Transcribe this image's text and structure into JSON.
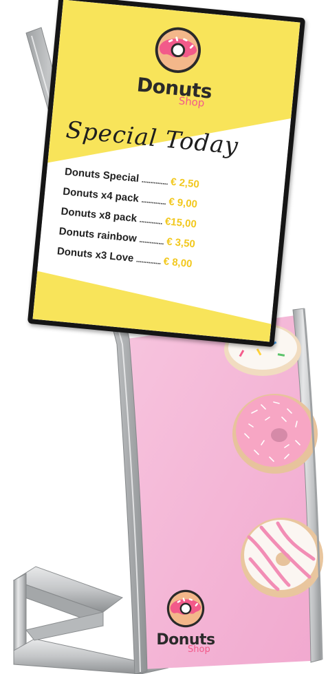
{
  "screen": {
    "brand_main": "Donuts",
    "brand_sub": "Shop",
    "special_title": "Special Today",
    "menu": [
      {
        "name": "Donuts Special",
        "dots": "...............",
        "price": "€ 2,50"
      },
      {
        "name": "Donuts x4 pack",
        "dots": "..............",
        "price": "€ 9,00"
      },
      {
        "name": "Donuts x8 pack",
        "dots": ".............",
        "price": "€15,00"
      },
      {
        "name": "Donuts rainbow",
        "dots": "..............",
        "price": "€ 3,50"
      },
      {
        "name": "Donuts x3 Love",
        "dots": "..............",
        "price": "€ 8,00"
      }
    ]
  },
  "poster": {
    "brand_main": "Donuts",
    "brand_sub": "Shop"
  },
  "colors": {
    "yellow": "#f8e45a",
    "price_gold": "#f2c81e",
    "pink_poster": "#f4b6d6",
    "frost_pink": "#f7a6c4",
    "frame": "#151515",
    "aluminum": "#c9cbcc"
  }
}
